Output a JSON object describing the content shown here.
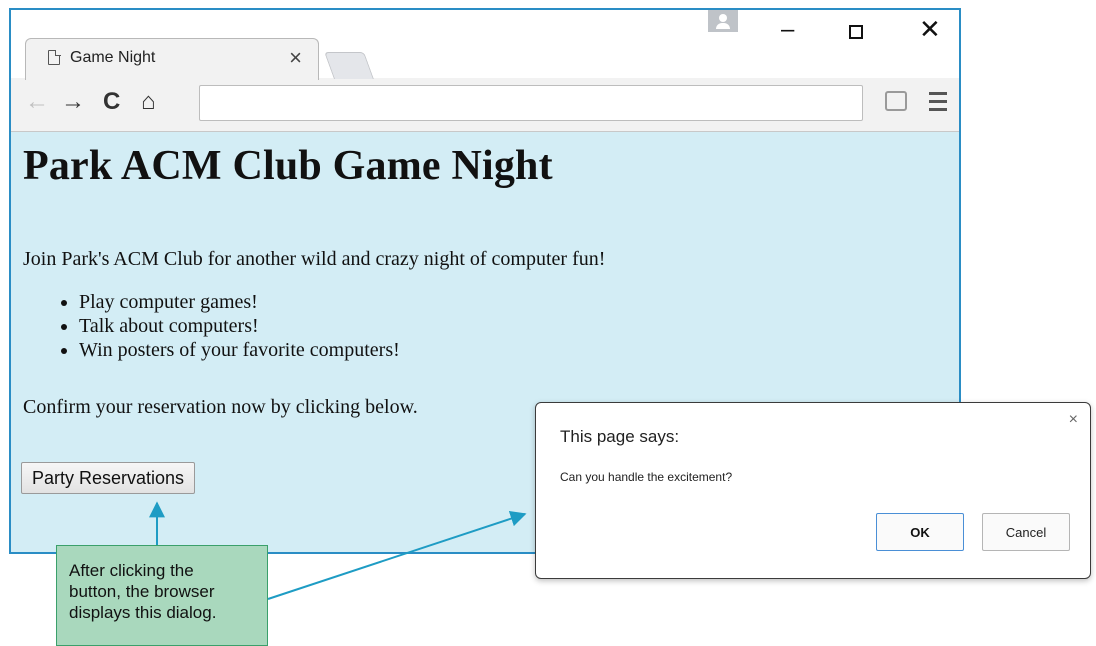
{
  "browser": {
    "tab_title": "Game Night",
    "tab_close": "×",
    "window_controls": {
      "minimize": "–",
      "close": "✕"
    },
    "nav": {
      "back": "←",
      "forward": "→",
      "reload": "C",
      "home": "⌂"
    },
    "address_value": "",
    "extension_icon": "ad-block-icon",
    "menu_icon": "hamburger-menu-icon"
  },
  "page": {
    "heading": "Park ACM Club Game Night",
    "intro": "Join Park's ACM Club for another wild and crazy night of computer fun!",
    "features": [
      "Play computer games!",
      "Talk about computers!",
      "Win posters of your favorite computers!"
    ],
    "confirm": "Confirm your reservation now by clicking below.",
    "button_label": "Party Reservations"
  },
  "dialog": {
    "title": "This page says:",
    "message": "Can you handle the excitement?",
    "close": "×",
    "ok_label": "OK",
    "cancel_label": "Cancel"
  },
  "callout": {
    "lines": [
      "After clicking the",
      "button, the browser",
      "displays this dialog."
    ]
  },
  "colors": {
    "window_border": "#2a8dc5",
    "page_background": "#d3edf5",
    "callout_fill": "#a9d8bd",
    "callout_border": "#3aa06b",
    "arrow": "#1e9cc4"
  }
}
